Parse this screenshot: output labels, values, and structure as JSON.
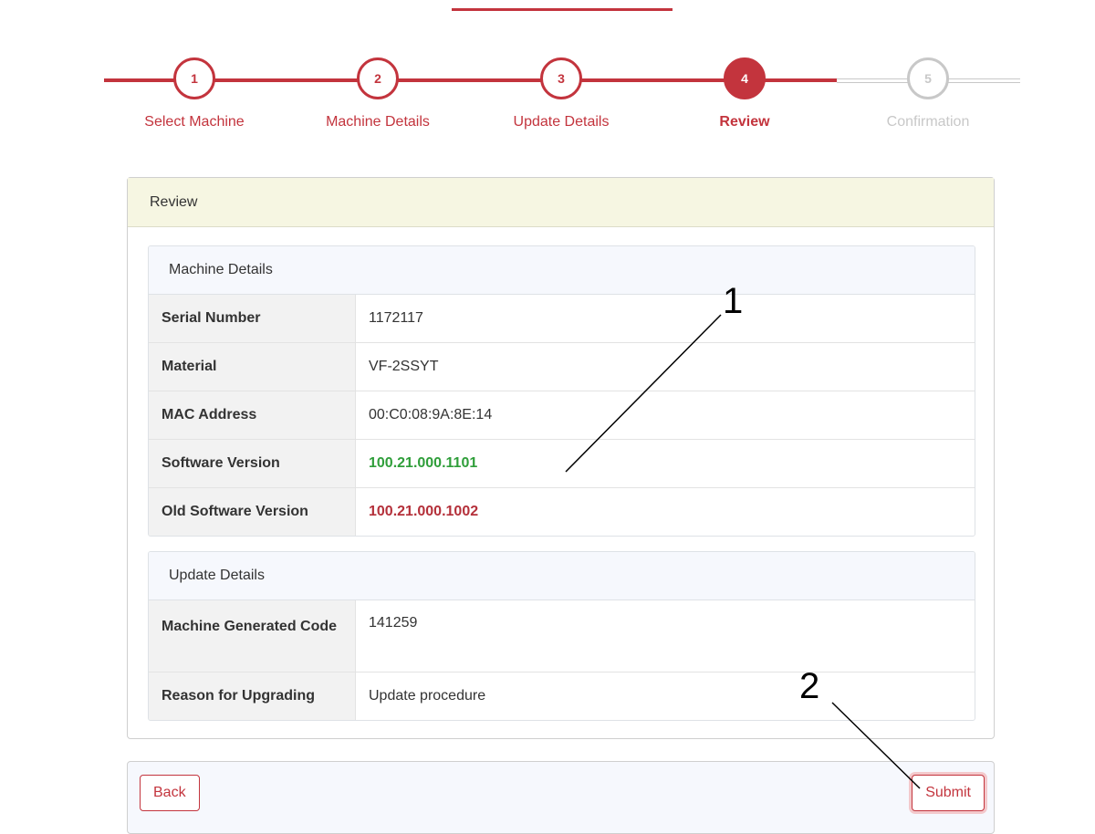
{
  "stepper": {
    "steps": [
      {
        "number": "1",
        "label": "Select Machine",
        "state": "complete"
      },
      {
        "number": "2",
        "label": "Machine Details",
        "state": "complete"
      },
      {
        "number": "3",
        "label": "Update Details",
        "state": "complete"
      },
      {
        "number": "4",
        "label": "Review",
        "state": "active"
      },
      {
        "number": "5",
        "label": "Confirmation",
        "state": "disabled"
      }
    ]
  },
  "review": {
    "header": "Review",
    "machine_details": {
      "title": "Machine Details",
      "rows": [
        {
          "label": "Serial Number",
          "value": "1172117"
        },
        {
          "label": "Material",
          "value": "VF-2SSYT"
        },
        {
          "label": "MAC Address",
          "value": "00:C0:08:9A:8E:14"
        },
        {
          "label": "Software Version",
          "value": "100.21.000.1101"
        },
        {
          "label": "Old Software Version",
          "value": "100.21.000.1002"
        }
      ]
    },
    "update_details": {
      "title": "Update Details",
      "rows": [
        {
          "label": "Machine Generated Code",
          "value": "141259"
        },
        {
          "label": "Reason for Upgrading",
          "value": "Update procedure"
        }
      ]
    }
  },
  "footer": {
    "back_label": "Back",
    "submit_label": "Submit"
  },
  "callouts": [
    "1",
    "2"
  ],
  "colors": {
    "accent": "#c3343d",
    "new_version": "#2f9e3a",
    "old_version": "#b4303a",
    "disabled": "#c8c8c8"
  }
}
